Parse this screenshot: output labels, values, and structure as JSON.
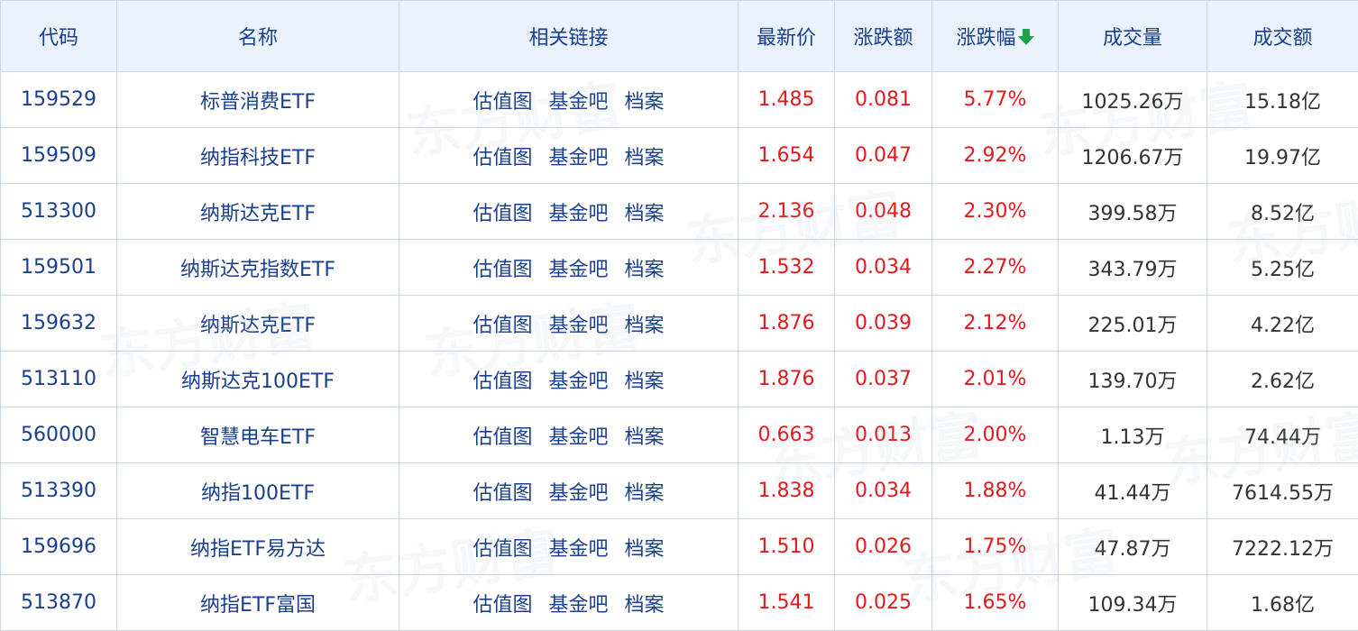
{
  "header": {
    "code": "代码",
    "name": "名称",
    "links": "相关链接",
    "price": "最新价",
    "change": "涨跌额",
    "change_pct": "涨跌幅",
    "volume": "成交量",
    "amount": "成交额"
  },
  "link_labels": {
    "valuation": "估值图",
    "forum": "基金吧",
    "profile": "档案"
  },
  "watermark": "东方财富",
  "colors": {
    "up": "#e5191d",
    "link": "#1a3f8c",
    "header_bg": "#eaf2fd",
    "sort_arrow": "#1fa34a"
  },
  "icons": {
    "sort": "arrow-down-icon"
  },
  "rows": [
    {
      "code": "159529",
      "name": "标普消费ETF",
      "price": "1.485",
      "change": "0.081",
      "change_pct": "5.77%",
      "volume": "1025.26万",
      "amount": "15.18亿"
    },
    {
      "code": "159509",
      "name": "纳指科技ETF",
      "price": "1.654",
      "change": "0.047",
      "change_pct": "2.92%",
      "volume": "1206.67万",
      "amount": "19.97亿"
    },
    {
      "code": "513300",
      "name": "纳斯达克ETF",
      "price": "2.136",
      "change": "0.048",
      "change_pct": "2.30%",
      "volume": "399.58万",
      "amount": "8.52亿"
    },
    {
      "code": "159501",
      "name": "纳斯达克指数ETF",
      "price": "1.532",
      "change": "0.034",
      "change_pct": "2.27%",
      "volume": "343.79万",
      "amount": "5.25亿"
    },
    {
      "code": "159632",
      "name": "纳斯达克ETF",
      "price": "1.876",
      "change": "0.039",
      "change_pct": "2.12%",
      "volume": "225.01万",
      "amount": "4.22亿"
    },
    {
      "code": "513110",
      "name": "纳斯达克100ETF",
      "price": "1.876",
      "change": "0.037",
      "change_pct": "2.01%",
      "volume": "139.70万",
      "amount": "2.62亿"
    },
    {
      "code": "560000",
      "name": "智慧电车ETF",
      "price": "0.663",
      "change": "0.013",
      "change_pct": "2.00%",
      "volume": "1.13万",
      "amount": "74.44万"
    },
    {
      "code": "513390",
      "name": "纳指100ETF",
      "price": "1.838",
      "change": "0.034",
      "change_pct": "1.88%",
      "volume": "41.44万",
      "amount": "7614.55万"
    },
    {
      "code": "159696",
      "name": "纳指ETF易方达",
      "price": "1.510",
      "change": "0.026",
      "change_pct": "1.75%",
      "volume": "47.87万",
      "amount": "7222.12万"
    },
    {
      "code": "513870",
      "name": "纳指ETF富国",
      "price": "1.541",
      "change": "0.025",
      "change_pct": "1.65%",
      "volume": "109.34万",
      "amount": "1.68亿"
    }
  ]
}
